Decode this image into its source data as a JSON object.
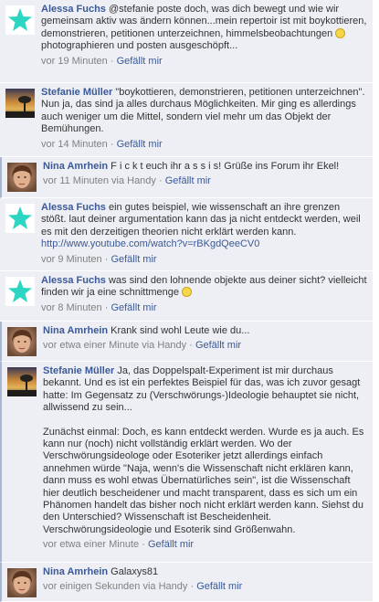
{
  "comments": [
    {
      "author": "Alessa Fuchs",
      "avatar": "cyan-star-avatar",
      "text_a": "@stefanie poste doch, was dich bewegt und wie wir gemeinsam aktiv was ändern können...mein repertoir ist mit boykottieren, demonstrieren, petitionen unterzeichnen, himmelsbeobachtungen",
      "text_b": "photographieren und posten ausgeschöpft...",
      "time": "vor 19 Minuten",
      "sep": "·",
      "like": "Gefällt mir"
    },
    {
      "author": "Stefanie Müller",
      "avatar": "sunset-tree-avatar",
      "text": "\"boykottieren, demonstrieren, petitionen unterzeichnen\". Nun ja, das sind ja alles durchaus Möglichkeiten. Mir ging es allerdings auch weniger um die Mittel, sondern viel mehr um das Objekt der Bemühungen.",
      "time": "vor 14 Minuten",
      "sep": "·",
      "like": "Gefällt mir"
    },
    {
      "author": "Nina Amrhein",
      "avatar": "face-photo-avatar",
      "text": "F i c k t euch ihr a s s i s! Grüße ins Forum ihr Ekel!",
      "time": "vor 11 Minuten via Handy",
      "sep": "·",
      "like": "Gefällt mir"
    },
    {
      "author": "Alessa Fuchs",
      "avatar": "cyan-star-avatar",
      "text": "ein gutes beispiel, wie wissenschaft an ihre grenzen stößt. laut deiner argumentation kann das ja nicht entdeckt werden, weil es mit den derzeitigen theorien nicht erklärt werden kann.",
      "link": "http://www.youtube.com/watch?v=rBKgdQeeCV0",
      "time": "vor 9 Minuten",
      "sep": "·",
      "like": "Gefällt mir"
    },
    {
      "author": "Alessa Fuchs",
      "avatar": "cyan-star-avatar",
      "text_a": "was sind den lohnende objekte aus deiner sicht? vielleicht finden wir ja eine schnittmenge",
      "time": "vor 8 Minuten",
      "sep": "·",
      "like": "Gefällt mir"
    },
    {
      "author": "Nina Amrhein",
      "avatar": "face-photo-avatar",
      "text": "Krank sind wohl Leute wie du...",
      "time": "vor etwa einer Minute via Handy",
      "sep": "·",
      "like": "Gefällt mir"
    },
    {
      "author": "Stefanie Müller",
      "avatar": "sunset-tree-avatar",
      "text": "Ja, das Doppelspalt-Experiment ist mir durchaus bekannt. Und es ist ein perfektes Beispiel für das, was ich zuvor gesagt hatte: Im Gegensatz zu (Verschwörungs-)Ideologie behauptet sie nicht, allwissend zu sein...",
      "text2": "Zunächst einmal: Doch, es kann entdeckt werden. Wurde es ja auch. Es kann nur (noch) nicht vollständig erklärt werden. Wo der Verschwörungsideologe oder Esoteriker jetzt allerdings einfach annehmen würde \"Naja, wenn's die Wissenschaft nicht erklären kann, dann muss es wohl etwas Übernatürliches sein\", ist die Wissenschaft hier deutlich bescheidener und macht transparent, dass es sich um ein Phänomen handelt das bisher noch nicht erklärt werden kann. Siehst du den Unterschied? Wissenschaft ist Bescheidenheit. Verschwörungsideologie und Esoterik sind Größenwahn.",
      "time": "vor etwa einer Minute",
      "sep": "·",
      "like": "Gefällt mir"
    },
    {
      "author": "Nina Amrhein",
      "avatar": "face-photo-avatar",
      "text": "Galaxys81",
      "time": "vor einigen Sekunden via Handy",
      "sep": "·",
      "like": "Gefällt mir"
    }
  ]
}
